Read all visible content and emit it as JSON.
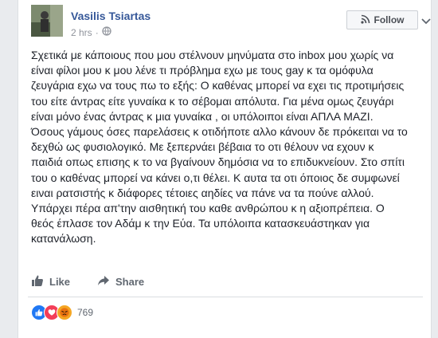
{
  "post": {
    "author": "Vasilis Tsiartas",
    "time": "2 hrs",
    "follow_label": "Follow",
    "lines": [
      "Σχετικά με κάποιους που μου στέλνουν μηνύματα στο inbox μου χωρίς να",
      "είναι φίλοι μου κ μου λένε τι πρόβλημα εχω με τους gay κ τα ομόφυλα",
      "ζευγάρια εχω να τους πω το εξής: Ο καθένας μπορεί να εχει τις προτιμήσεις",
      "του είτε άντρας είτε γυναίκα κ το σέβομαι απόλυτα. Για μένα ομως ζευγάρι",
      "είναι μόνο ένας άντρας κ μια γυναίκα , οι υπόλοιποι είναι ΑΠΛΑ ΜΑΖΙ.",
      "Όσους γάμους όσες παρελάσεις κ οτιδήποτε αλλο κάνουν δε πρόκειται να το",
      "δεχθώ ως φυσιολογικό. Με ξεπερνάει βέβαια το οτι θέλουν να εχουν κ",
      "παιδιά οπως επισης κ το να βγαίνουν δημόσια να το επιδυκνείουν. Στο σπίτι",
      "του ο καθένας μπορεί να κάνει ο,τι θέλει. Κ αυτα τα οτι όποιος δε συμφωνεί",
      "ειναι ρατσιστής κ διάφορες τέτοιες αηδίες να πάνε να τα πούνε αλλού.",
      "Υπάρχει πέρα απ'την αισθητική του καθε ανθρώπου κ η αξιοπρέπεια. Ο",
      "θεός έπλασε τον Αδάμ κ την Εύα. Τα υπόλοιπα κατασκευάστηκαν για",
      "κατανάλωση."
    ]
  },
  "actions": {
    "like_label": "Like",
    "share_label": "Share"
  },
  "reactions": {
    "count": "769",
    "types": [
      "like-icon",
      "love-icon",
      "angry-icon"
    ]
  },
  "colors": {
    "link": "#365899",
    "text": "#1d2129",
    "muted": "#90949c",
    "like_blue": "#2078f4",
    "love_red": "#f33e58",
    "angry_orange": "#e9710f"
  }
}
